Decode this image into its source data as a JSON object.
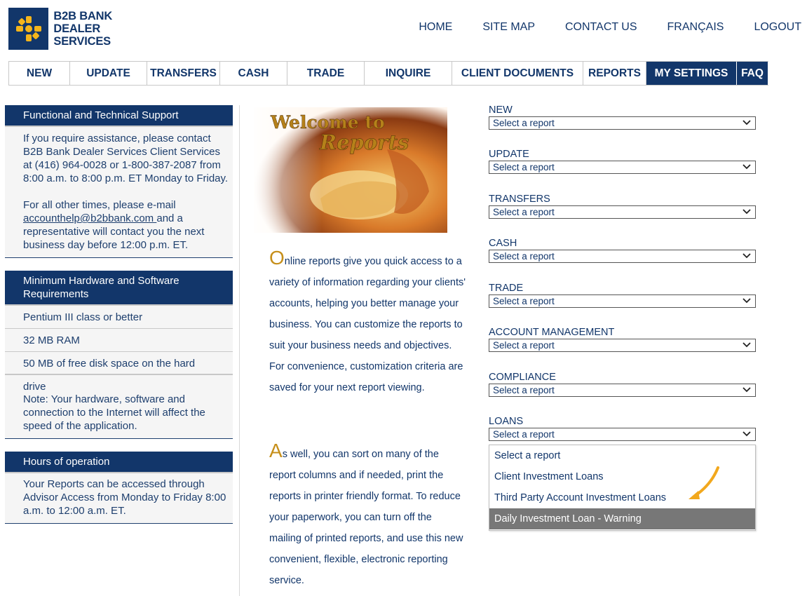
{
  "brand": {
    "line1": "B2B BANK",
    "line2": "DEALER SERVICES",
    "color": "#12366a",
    "accent": "#f5b51b"
  },
  "topnav": [
    "HOME",
    "SITE MAP",
    "CONTACT US",
    "FRANÇAIS",
    "LOGOUT"
  ],
  "mainnav": [
    "NEW",
    "UPDATE",
    "TRANSFERS",
    "CASH",
    "TRADE",
    "INQUIRE",
    "CLIENT DOCUMENTS",
    "REPORTS",
    "MY SETTINGS",
    "FAQ"
  ],
  "sidebar": {
    "support": {
      "title": "Functional and Technical Support",
      "p1": "If you require assistance, please contact B2B Bank Dealer Services Client Services at (416) 964-0028 or 1-800-387-2087 from 8:00 a.m. to 8:00 p.m. ET Monday to Friday.",
      "p2_before": "For all other times, please e-mail ",
      "email": "accounthelp@b2bbank.com ",
      "p2_after": "and a representative will contact you the next business day before 12:00 p.m. ET."
    },
    "hardware": {
      "title": "Minimum Hardware and Software Requirements",
      "items": [
        "Pentium III class or better",
        "32 MB RAM",
        "50 MB of free disk space on the hard drive"
      ],
      "note": "Note: Your hardware, software and connection to the Internet will affect the speed of the application."
    },
    "hours": {
      "title": "Hours of operation",
      "text": "Your Reports can be accessed through Advisor Access from Monday to Friday 8:00 a.m. to 12:00 a.m. ET."
    }
  },
  "welcome": {
    "line1": "Welcome to",
    "line2": "Reports",
    "para1_cap": "O",
    "para1": "nline reports give you quick access to a variety of information regarding your clients' accounts, helping you better manage your business. You can customize the reports to suit your business needs and objectives. For convenience, customization criteria are saved for your next report viewing.",
    "para2_cap": "A",
    "para2": "s well, you can sort on many of the report columns and if needed, print the reports in printer friendly format. To reduce your paperwork, you can turn off the mailing of printed reports, and use this new convenient, flexible, electronic reporting service."
  },
  "reports": {
    "placeholder": "Select a report",
    "groups": [
      "NEW",
      "UPDATE",
      "TRANSFERS",
      "CASH",
      "TRADE",
      "ACCOUNT MANAGEMENT",
      "COMPLIANCE",
      "LOANS"
    ],
    "loans_options": [
      "Select a report",
      "Client Investment Loans",
      "Third Party Account Investment Loans",
      "Daily Investment Loan - Warning"
    ],
    "highlighted_option": "Daily Investment Loan - Warning"
  }
}
